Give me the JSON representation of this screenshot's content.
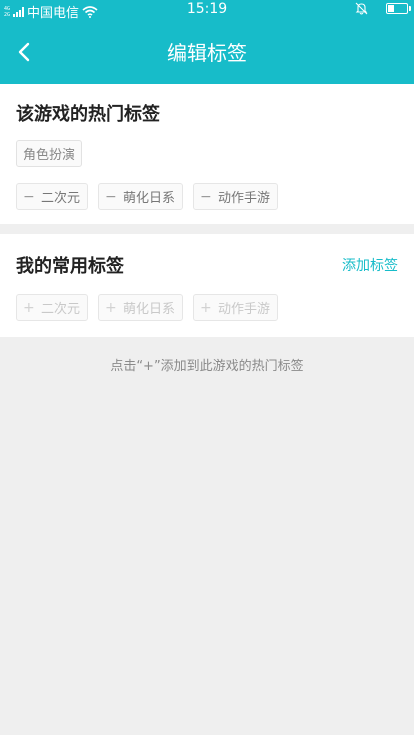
{
  "status": {
    "signal_top": "4G",
    "signal_bottom": "2G",
    "carrier": "中国电信",
    "time": "15:19",
    "battery_level": 0.35
  },
  "nav": {
    "title": "编辑标签"
  },
  "hot_section": {
    "title": "该游戏的热门标签",
    "main_tag": "角色扮演",
    "tags": [
      {
        "symbol": "−",
        "label": "二次元"
      },
      {
        "symbol": "−",
        "label": "萌化日系"
      },
      {
        "symbol": "−",
        "label": "动作手游"
      }
    ]
  },
  "common_section": {
    "title": "我的常用标签",
    "add_label": "添加标签",
    "tags": [
      {
        "symbol": "+",
        "label": "二次元"
      },
      {
        "symbol": "+",
        "label": "萌化日系"
      },
      {
        "symbol": "+",
        "label": "动作手游"
      }
    ]
  },
  "hint": "点击“+”添加到此游戏的热门标签",
  "colors": {
    "accent": "#17bcc9",
    "background": "#efefef"
  },
  "icons": [
    "signal-icon",
    "wifi-icon",
    "bell-muted-icon",
    "battery-icon",
    "back-arrow-icon"
  ]
}
